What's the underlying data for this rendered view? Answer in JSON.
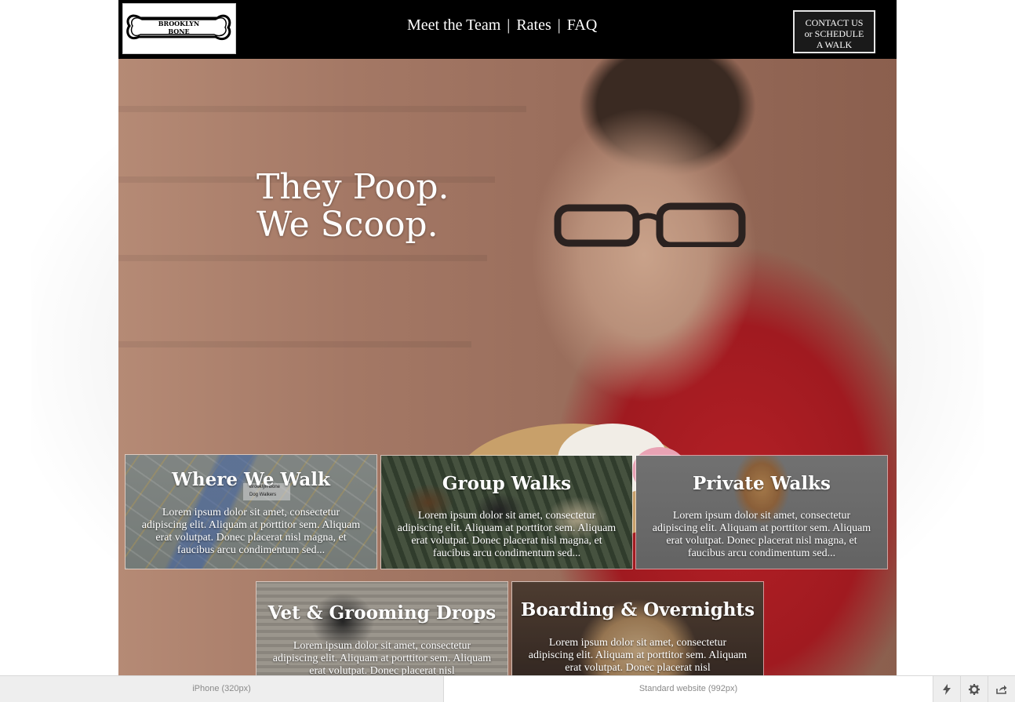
{
  "header": {
    "logo_line1": "BROOKLYN",
    "logo_line2": "BONE",
    "nav": {
      "team": "Meet the Team",
      "rates": "Rates",
      "faq": "FAQ",
      "separator": "|"
    },
    "contact_line1": "CONTACT US",
    "contact_line2": "or SCHEDULE",
    "contact_line3": "A WALK"
  },
  "hero": {
    "tagline_line1": "They Poop.",
    "tagline_line2": "We Scoop."
  },
  "cards": [
    {
      "title": "Where We Walk",
      "body": "Lorem ipsum dolor sit amet, consectetur adipiscing elit. Aliquam at porttitor sem. Aliquam erat volutpat. Donec placerat nisl magna, et faucibus arcu condimentum sed...",
      "map_label1": "Brooklyn Bone",
      "map_label2": "Dog Walkers"
    },
    {
      "title": "Group Walks",
      "body": "Lorem ipsum dolor sit amet, consectetur adipiscing elit. Aliquam at porttitor sem. Aliquam erat volutpat. Donec placerat nisl magna, et faucibus arcu condimentum sed..."
    },
    {
      "title": "Private Walks",
      "body": "Lorem ipsum dolor sit amet, consectetur adipiscing elit. Aliquam at porttitor sem. Aliquam erat volutpat. Donec placerat nisl magna, et faucibus arcu condimentum sed..."
    },
    {
      "title": "Vet & Grooming Drops",
      "body": "Lorem ipsum dolor sit amet, consectetur adipiscing elit. Aliquam at porttitor sem. Aliquam erat volutpat. Donec placerat nisl"
    },
    {
      "title": "Boarding & Overnights",
      "body": "Lorem ipsum dolor sit amet, consectetur adipiscing elit. Aliquam at porttitor sem. Aliquam erat volutpat. Donec placerat nisl"
    }
  ],
  "toolbar": {
    "iphone_label": "iPhone (320px)",
    "standard_label": "Standard website (992px)",
    "buttons": [
      "lightning-icon",
      "gear-icon",
      "share-icon"
    ]
  }
}
